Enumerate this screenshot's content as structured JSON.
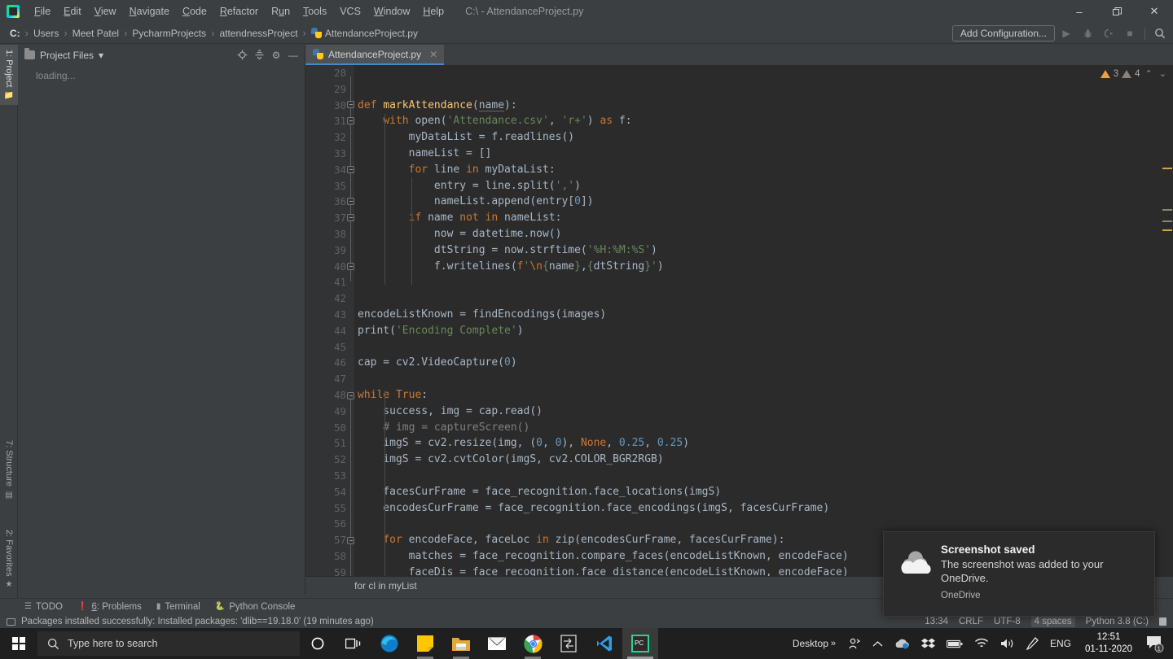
{
  "titlebar": {
    "app_icon": "pycharm-logo-icon",
    "window_title": "C:\\ - AttendanceProject.py",
    "menu": [
      "File",
      "Edit",
      "View",
      "Navigate",
      "Code",
      "Refactor",
      "Run",
      "Tools",
      "VCS",
      "Window",
      "Help"
    ],
    "minimize": "–",
    "maximize": "❐",
    "close": "✕"
  },
  "navbar": {
    "breadcrumbs": [
      "C:",
      "Users",
      "Meet Patel",
      "PycharmProjects",
      "attendnessProject",
      "AttendanceProject.py"
    ],
    "separator": "›",
    "add_configuration": "Add Configuration...",
    "buttons": [
      "run-icon",
      "debug-icon",
      "run-coverage-icon",
      "stop-icon",
      "search-everywhere-icon"
    ]
  },
  "rail": {
    "top": {
      "label": "1: Project",
      "icon": "folder-icon"
    },
    "structure": {
      "label": "7: Structure",
      "icon": "structure-icon"
    },
    "favorites": {
      "label": "2: Favorites",
      "icon": "star-icon"
    }
  },
  "project_panel": {
    "title": "Project Files",
    "dropdown_caret": "▾",
    "actions": [
      "locate-icon",
      "collapse-all-icon",
      "settings-gear-icon",
      "hide-icon"
    ],
    "body_text": "loading..."
  },
  "editor": {
    "tab": {
      "label": "AttendanceProject.py",
      "close": "✕",
      "icon": "python-file-icon"
    },
    "inspections": {
      "warning_count": "3",
      "weak_warning_count": "4",
      "prev": "⌃",
      "next": "⌄"
    },
    "breadcrumb": "for cl in myList",
    "first_line_number": 28,
    "lines": [
      {
        "n": 28,
        "html": ""
      },
      {
        "n": 29,
        "html": ""
      },
      {
        "n": 30,
        "html": "<span class=\"kw\">def</span> <span class=\"fn\">markAttendance</span>(<span class=\"param\">name</span>):"
      },
      {
        "n": 31,
        "html": "    <span class=\"kw\">with</span> open(<span class=\"str\">'Attendance.csv'</span>, <span class=\"str\">'r+'</span>) <span class=\"kw\">as</span> f:"
      },
      {
        "n": 32,
        "html": "        myDataList = f.readlines()"
      },
      {
        "n": 33,
        "html": "        nameList = []"
      },
      {
        "n": 34,
        "html": "        <span class=\"kw\">for</span> line <span class=\"kw\">in</span> myDataList:"
      },
      {
        "n": 35,
        "html": "            entry = line.split(<span class=\"str\">','</span>)"
      },
      {
        "n": 36,
        "html": "            nameList.append(entry[<span class=\"num\">0</span>])"
      },
      {
        "n": 37,
        "html": "        <span class=\"kw\">if</span> name <span class=\"kw\">not in</span> nameList:"
      },
      {
        "n": 38,
        "html": "            now = datetime.now()"
      },
      {
        "n": 39,
        "html": "            dtString = now.strftime(<span class=\"str\">'%H:%M:%S'</span>)"
      },
      {
        "n": 40,
        "html": "            f.writelines(<span class=\"kw\">f</span><span class=\"str\">'</span><span class=\"kw\">\\n</span><span class=\"str\">{</span>name<span class=\"str\">}</span>,<span class=\"str\">{</span>dtString<span class=\"str\">}'</span>)"
      },
      {
        "n": 41,
        "html": ""
      },
      {
        "n": 42,
        "html": ""
      },
      {
        "n": 43,
        "html": "encodeListKnown = findEncodings(images)"
      },
      {
        "n": 44,
        "html": "print(<span class=\"str\">'Encoding Complete'</span>)"
      },
      {
        "n": 45,
        "html": ""
      },
      {
        "n": 46,
        "html": "cap = cv2.VideoCapture(<span class=\"num\">0</span>)"
      },
      {
        "n": 47,
        "html": ""
      },
      {
        "n": 48,
        "html": "<span class=\"kw\">while True</span>:"
      },
      {
        "n": 49,
        "html": "    success, img = cap.read()"
      },
      {
        "n": 50,
        "html": "    <span class=\"com\"># img = captureScreen()</span>"
      },
      {
        "n": 51,
        "html": "    imgS = cv2.resize(img, (<span class=\"num\">0</span>, <span class=\"num\">0</span>), <span class=\"kw\">None</span>, <span class=\"num\">0.25</span>, <span class=\"num\">0.25</span>)"
      },
      {
        "n": 52,
        "html": "    imgS = cv2.cvtColor(imgS, cv2.COLOR_BGR2RGB)"
      },
      {
        "n": 53,
        "html": ""
      },
      {
        "n": 54,
        "html": "    facesCurFrame = face_recognition.face_locations(imgS)"
      },
      {
        "n": 55,
        "html": "    encodesCurFrame = face_recognition.face_encodings(imgS, facesCurFrame)"
      },
      {
        "n": 56,
        "html": ""
      },
      {
        "n": 57,
        "html": "    <span class=\"kw\">for</span> encodeFace, faceLoc <span class=\"kw\">in</span> zip(encodesCurFrame, facesCurFrame):"
      },
      {
        "n": 58,
        "html": "        matches = face_recognition.compare_faces(encodeListKnown, encodeFace)"
      },
      {
        "n": 59,
        "html": "        faceDis = face_recognition.face_distance(encodeListKnown, encodeFace)"
      }
    ]
  },
  "bottom_toolwindows": [
    {
      "label": "TODO",
      "icon": "todo-list-icon"
    },
    {
      "label": "6: Problems",
      "icon": "problems-icon"
    },
    {
      "label": "Terminal",
      "icon": "terminal-icon"
    },
    {
      "label": "Python Console",
      "icon": "python-console-icon"
    }
  ],
  "statusbar": {
    "message": "Packages installed successfully: Installed packages: 'dlib==19.18.0' (19 minutes ago)",
    "caret_position": "13:34",
    "line_separator": "CRLF",
    "encoding": "UTF-8",
    "indent": "4 spaces",
    "interpreter": "Python 3.8 (C:)",
    "lock_icon": "read-only-lock-icon"
  },
  "toast": {
    "icon": "onedrive-cloud-icon",
    "title": "Screenshot saved",
    "body": "The screenshot was added to your OneDrive.",
    "app": "OneDrive"
  },
  "taskbar": {
    "start": "windows-start-icon",
    "search_placeholder": "Type here to search",
    "search_icon": "search-icon",
    "cortana": "cortana-icon",
    "task_view": "task-view-icon",
    "apps": [
      {
        "name": "microsoft-edge-icon",
        "running": false
      },
      {
        "name": "sticky-notes-icon",
        "running": true
      },
      {
        "name": "file-explorer-icon",
        "running": true
      },
      {
        "name": "mail-icon",
        "running": false
      },
      {
        "name": "google-chrome-icon",
        "running": true
      },
      {
        "name": "snipping-tool-icon",
        "running": false
      },
      {
        "name": "visual-studio-code-icon",
        "running": false
      },
      {
        "name": "pycharm-icon",
        "running": true
      }
    ],
    "tray": {
      "desktop_label": "Desktop",
      "overflow": "»",
      "meet_now": "meet-now-icon",
      "show_hidden": "⌃",
      "onedrive": "onedrive-tray-icon",
      "dropbox": "dropbox-icon",
      "battery": "battery-icon",
      "wifi": "wifi-icon",
      "volume": "volume-icon",
      "pen": "windows-ink-icon",
      "language": "ENG",
      "time": "12:51",
      "date": "01-11-2020",
      "notification_count": "1"
    }
  },
  "colors": {
    "chrome": "#3c3f41",
    "editor_bg": "#2b2b2b",
    "gutter_bg": "#313335",
    "accent_blue": "#4a88c7",
    "keyword_orange": "#cc7832",
    "string_green": "#6a8759",
    "number_blue": "#6897bb",
    "function_yellow": "#ffc66d",
    "comment_grey": "#808080",
    "warning_orange": "#e8a33d"
  }
}
